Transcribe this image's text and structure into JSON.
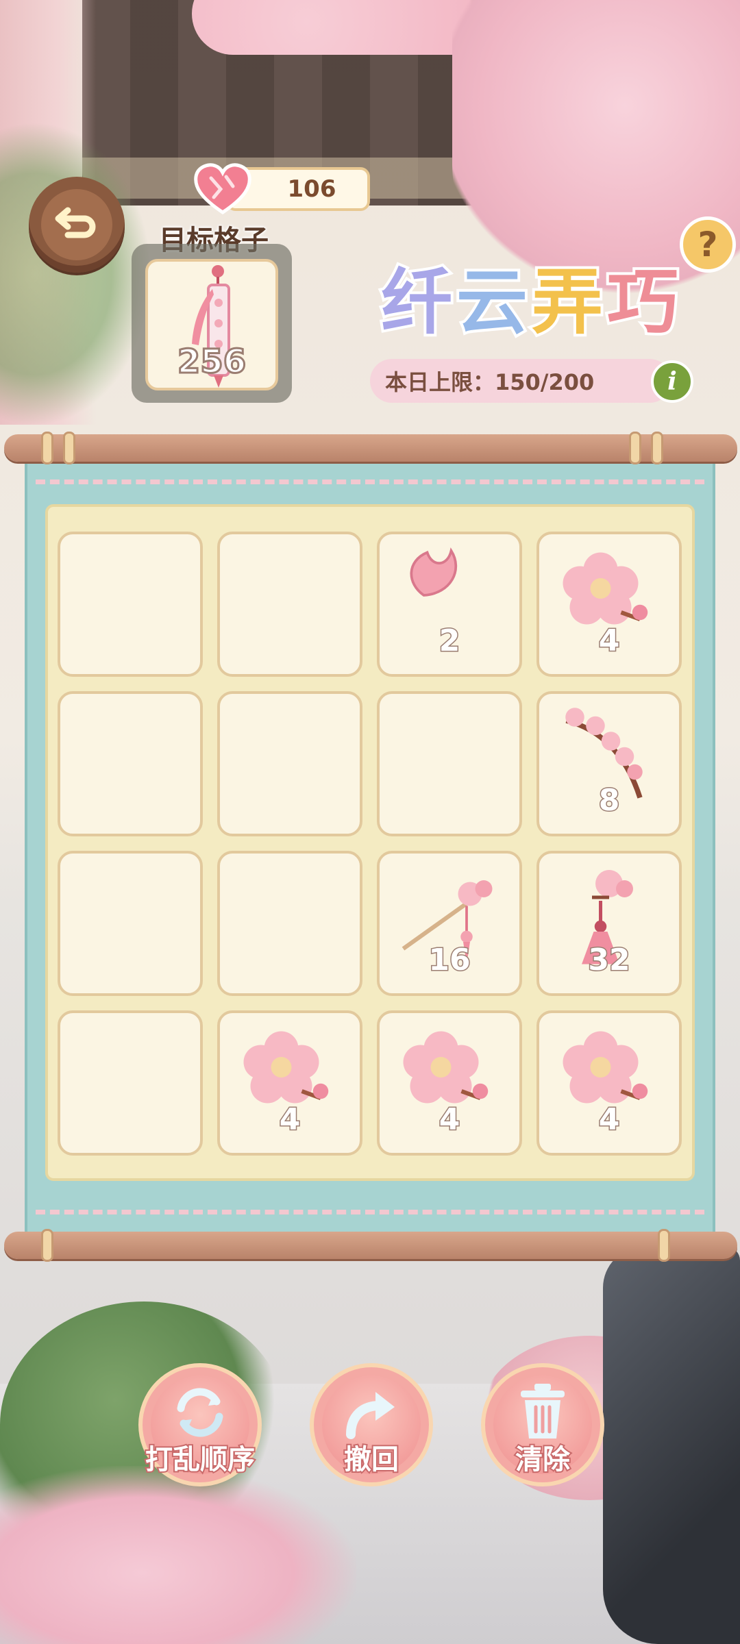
{
  "currency": {
    "value": "106"
  },
  "target": {
    "label": "目标格子",
    "value": "256"
  },
  "title": {
    "part1": "纤",
    "part2": "云",
    "part3": "弄",
    "part4": "巧"
  },
  "daily_limit": {
    "text": "本日上限：150/200"
  },
  "help_glyph": "?",
  "info_glyph": "i",
  "grid": {
    "rows": [
      [
        {
          "value": null
        },
        {
          "value": null
        },
        {
          "value": "2",
          "item": "petal"
        },
        {
          "value": "4",
          "item": "blossom"
        }
      ],
      [
        {
          "value": null
        },
        {
          "value": null
        },
        {
          "value": null
        },
        {
          "value": "8",
          "item": "branch"
        }
      ],
      [
        {
          "value": null
        },
        {
          "value": null
        },
        {
          "value": "16",
          "item": "hairpin"
        },
        {
          "value": "32",
          "item": "tassel"
        }
      ],
      [
        {
          "value": null
        },
        {
          "value": "4",
          "item": "blossom"
        },
        {
          "value": "4",
          "item": "blossom"
        },
        {
          "value": "4",
          "item": "blossom"
        }
      ]
    ]
  },
  "actions": {
    "shuffle": {
      "label": "打乱顺序",
      "icon": "shuffle-icon"
    },
    "undo": {
      "label": "撤回",
      "icon": "undo-arrow-icon"
    },
    "clear": {
      "label": "清除",
      "icon": "trash-icon"
    }
  },
  "colors": {
    "accent_pink": "#f4a9a4",
    "scroll_teal": "#a7d3d1",
    "board_cream": "#f4ebc2",
    "number_stroke": "#9a7d71"
  }
}
